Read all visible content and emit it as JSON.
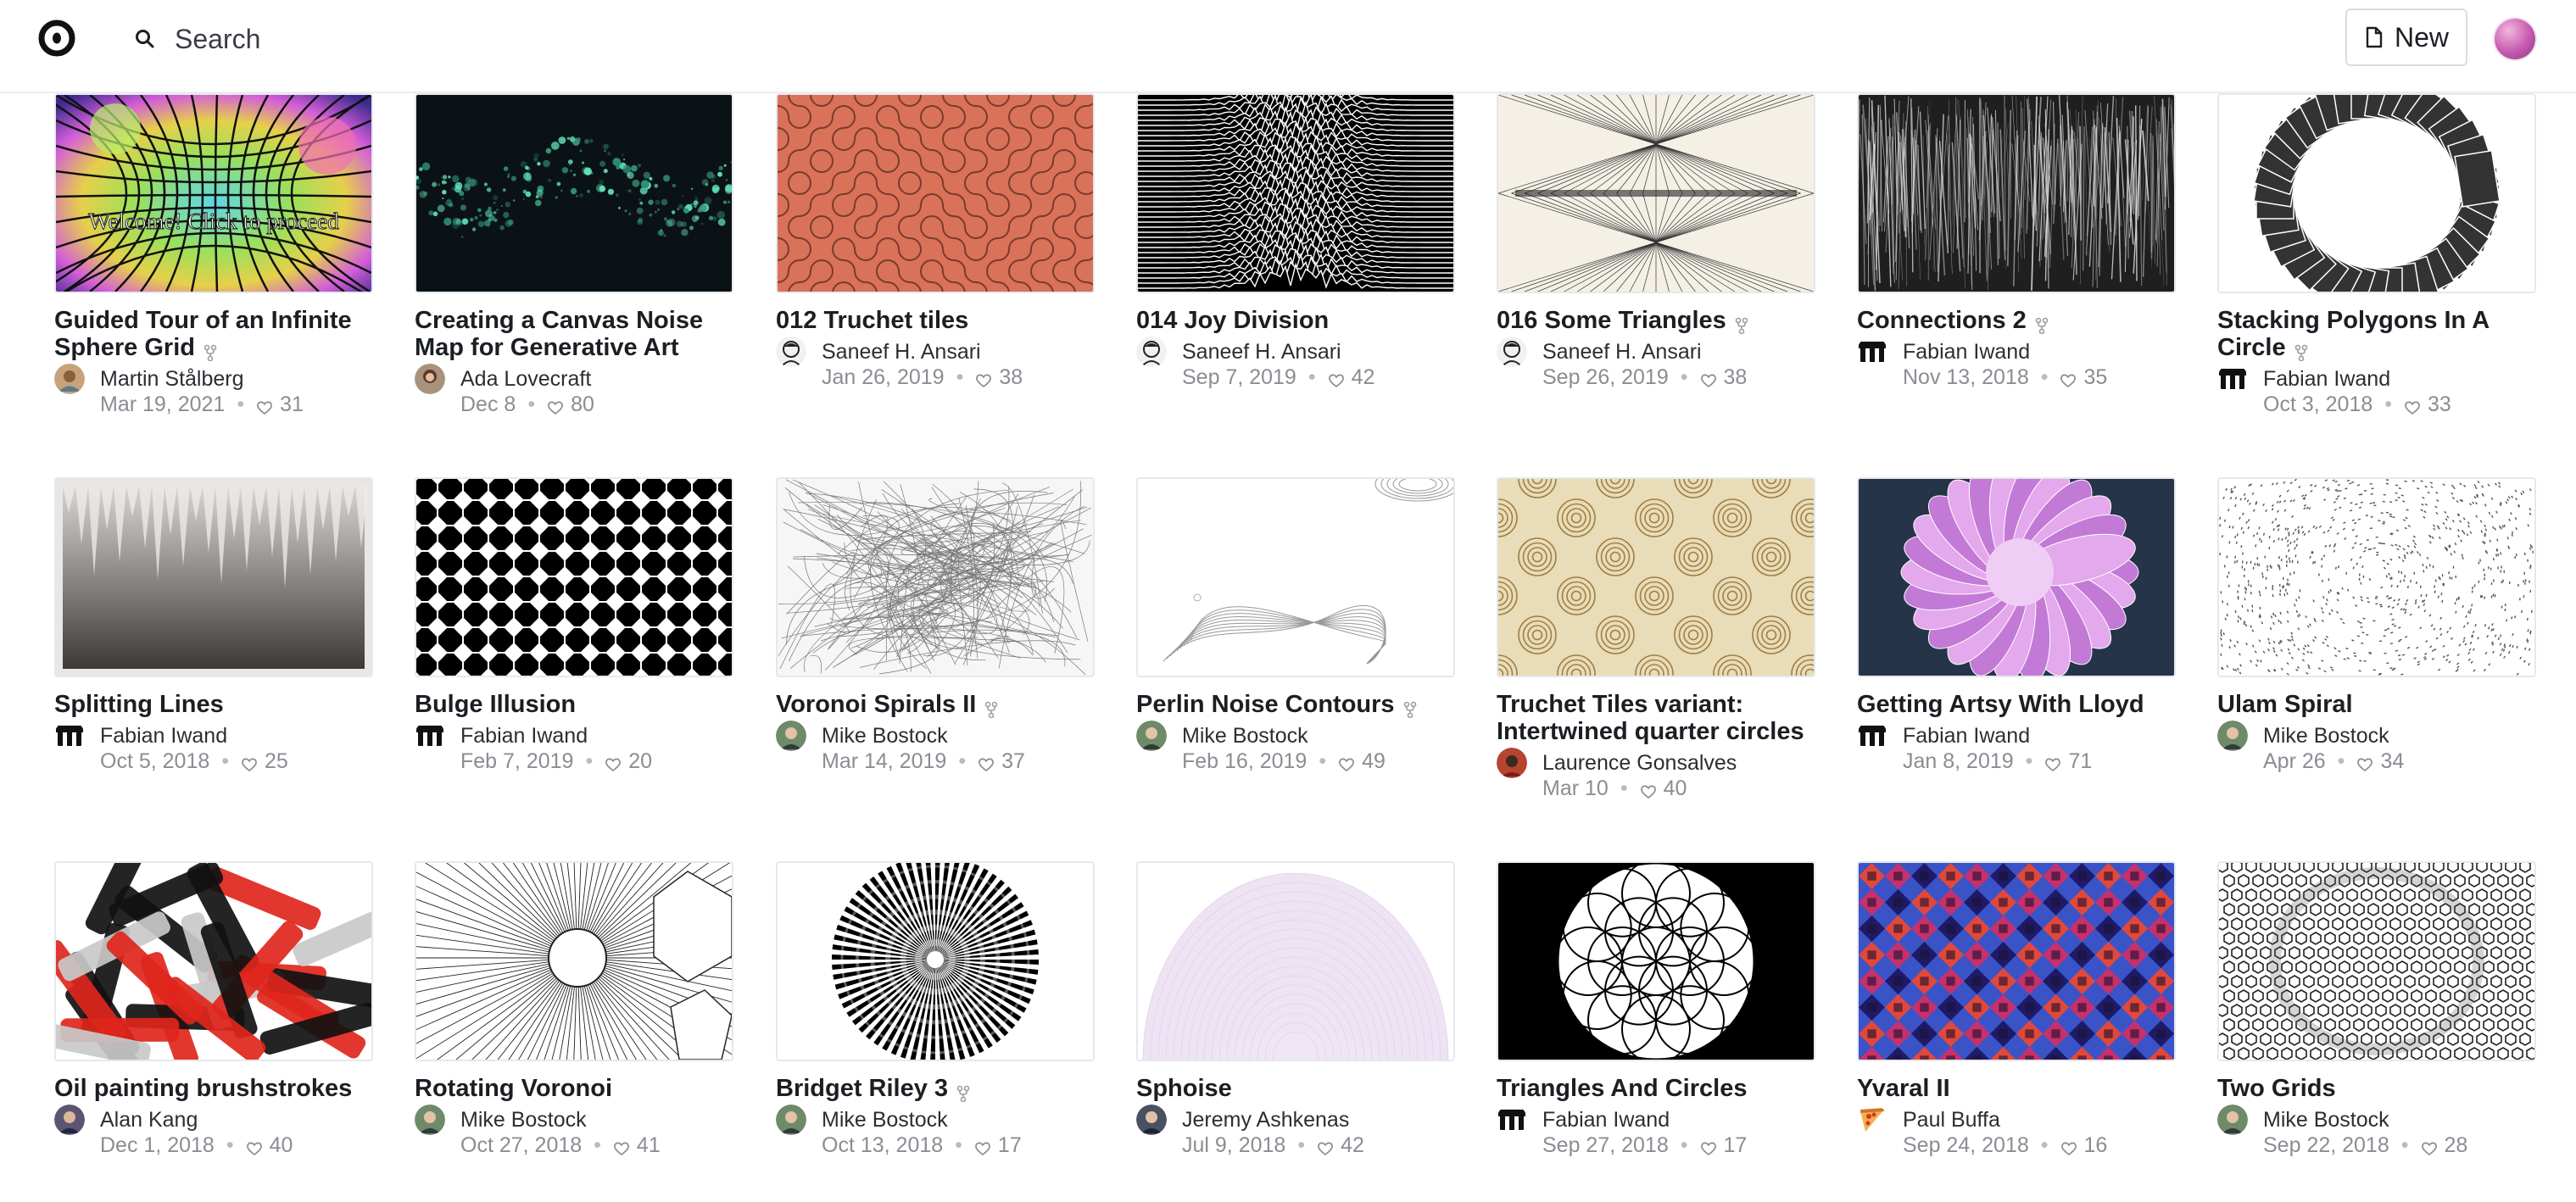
{
  "search": {
    "label": "Search"
  },
  "new_button": {
    "label": "New"
  },
  "notebooks": [
    {
      "title": "Guided Tour of an Infinite Sphere Grid",
      "author": "Martin Stålberg",
      "date": "Mar 19, 2021",
      "likes": "31",
      "forked": true,
      "thumb": "sphere",
      "avatar": "photo-a",
      "thumb_text": "Welcome! Click to proceed"
    },
    {
      "title": "Creating a Canvas Noise Map for Generative Art",
      "author": "Ada Lovecraft",
      "date": "Dec 8",
      "likes": "80",
      "forked": false,
      "thumb": "noise",
      "avatar": "photo-b"
    },
    {
      "title": "012 Truchet tiles",
      "author": "Saneef H. Ansari",
      "date": "Jan 26, 2019",
      "likes": "38",
      "forked": false,
      "thumb": "truchet",
      "avatar": "sketch"
    },
    {
      "title": "014 Joy Division",
      "author": "Saneef H. Ansari",
      "date": "Sep 7, 2019",
      "likes": "42",
      "forked": false,
      "thumb": "joy",
      "avatar": "sketch"
    },
    {
      "title": "016 Some Triangles",
      "author": "Saneef H. Ansari",
      "date": "Sep 26, 2019",
      "likes": "38",
      "forked": true,
      "thumb": "triangles",
      "avatar": "sketch"
    },
    {
      "title": "Connections 2",
      "author": "Fabian Iwand",
      "date": "Nov 13, 2018",
      "likes": "35",
      "forked": true,
      "thumb": "connections",
      "avatar": "pixel"
    },
    {
      "title": "Stacking Polygons In A Circle",
      "author": "Fabian Iwand",
      "date": "Oct 3, 2018",
      "likes": "33",
      "forked": true,
      "thumb": "polygons",
      "avatar": "pixel"
    },
    {
      "title": "Splitting Lines",
      "author": "Fabian Iwand",
      "date": "Oct 5, 2018",
      "likes": "25",
      "forked": false,
      "thumb": "splitting",
      "avatar": "pixel"
    },
    {
      "title": "Bulge Illusion",
      "author": "Fabian Iwand",
      "date": "Feb 7, 2019",
      "likes": "20",
      "forked": false,
      "thumb": "bulge",
      "avatar": "pixel"
    },
    {
      "title": "Voronoi Spirals II",
      "author": "Mike Bostock",
      "date": "Mar 14, 2019",
      "likes": "37",
      "forked": true,
      "thumb": "voronoi",
      "avatar": "photo-c"
    },
    {
      "title": "Perlin Noise Contours",
      "author": "Mike Bostock",
      "date": "Feb 16, 2019",
      "likes": "49",
      "forked": true,
      "thumb": "perlin",
      "avatar": "photo-c"
    },
    {
      "title": "Truchet Tiles variant: Intertwined quarter circles",
      "author": "Laurence Gonsalves",
      "date": "Mar 10",
      "likes": "40",
      "forked": false,
      "thumb": "quarter",
      "avatar": "photo-d"
    },
    {
      "title": "Getting Artsy With Lloyd",
      "author": "Fabian Iwand",
      "date": "Jan 8, 2019",
      "likes": "71",
      "forked": false,
      "thumb": "lloyd",
      "avatar": "pixel"
    },
    {
      "title": "Ulam Spiral",
      "author": "Mike Bostock",
      "date": "Apr 26",
      "likes": "34",
      "forked": false,
      "thumb": "ulam",
      "avatar": "photo-c"
    },
    {
      "title": "Oil painting brushstrokes",
      "author": "Alan Kang",
      "date": "Dec 1, 2018",
      "likes": "40",
      "forked": false,
      "thumb": "oil",
      "avatar": "photo-e"
    },
    {
      "title": "Rotating Voronoi",
      "author": "Mike Bostock",
      "date": "Oct 27, 2018",
      "likes": "41",
      "forked": false,
      "thumb": "rotvoronoi",
      "avatar": "photo-c"
    },
    {
      "title": "Bridget Riley 3",
      "author": "Mike Bostock",
      "date": "Oct 13, 2018",
      "likes": "17",
      "forked": true,
      "thumb": "riley",
      "avatar": "photo-c"
    },
    {
      "title": "Sphoise",
      "author": "Jeremy Ashkenas",
      "date": "Jul 9, 2018",
      "likes": "42",
      "forked": false,
      "thumb": "sphoise",
      "avatar": "photo-f"
    },
    {
      "title": "Triangles And Circles",
      "author": "Fabian Iwand",
      "date": "Sep 27, 2018",
      "likes": "17",
      "forked": false,
      "thumb": "flower",
      "avatar": "pixel"
    },
    {
      "title": "Yvaral II",
      "author": "Paul Buffa",
      "date": "Sep 24, 2018",
      "likes": "16",
      "forked": false,
      "thumb": "yvaral",
      "avatar": "pizza"
    },
    {
      "title": "Two Grids",
      "author": "Mike Bostock",
      "date": "Sep 22, 2018",
      "likes": "28",
      "forked": false,
      "thumb": "twogrids",
      "avatar": "photo-c"
    }
  ]
}
